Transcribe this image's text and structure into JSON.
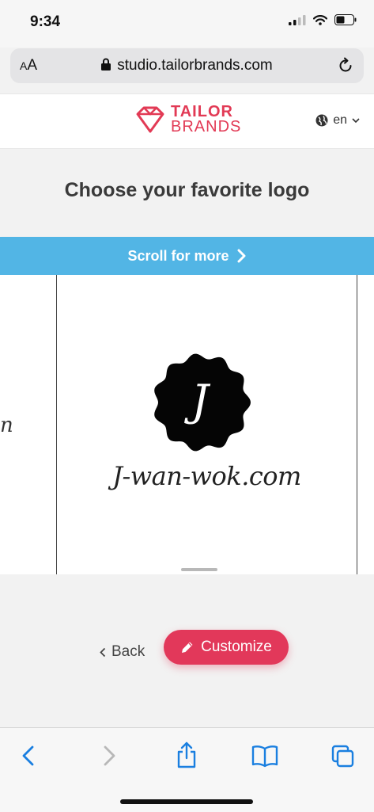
{
  "status": {
    "time": "9:34"
  },
  "browser": {
    "text_size_label": "AA",
    "url": "studio.tailorbrands.com"
  },
  "header": {
    "brand_line1": "TAILOR",
    "brand_line2": "BRANDS",
    "language": "en"
  },
  "main": {
    "headline": "Choose your favorite logo",
    "scroll_label": "Scroll for more",
    "logo_initial": "J",
    "logo_name": "J-wan-wok.com",
    "side_peek_text": "n"
  },
  "actions": {
    "back_label": "Back",
    "customize_label": "Customize"
  },
  "colors": {
    "brand": "#e23a55",
    "banner": "#52b5e5",
    "link": "#1a7fe0"
  }
}
